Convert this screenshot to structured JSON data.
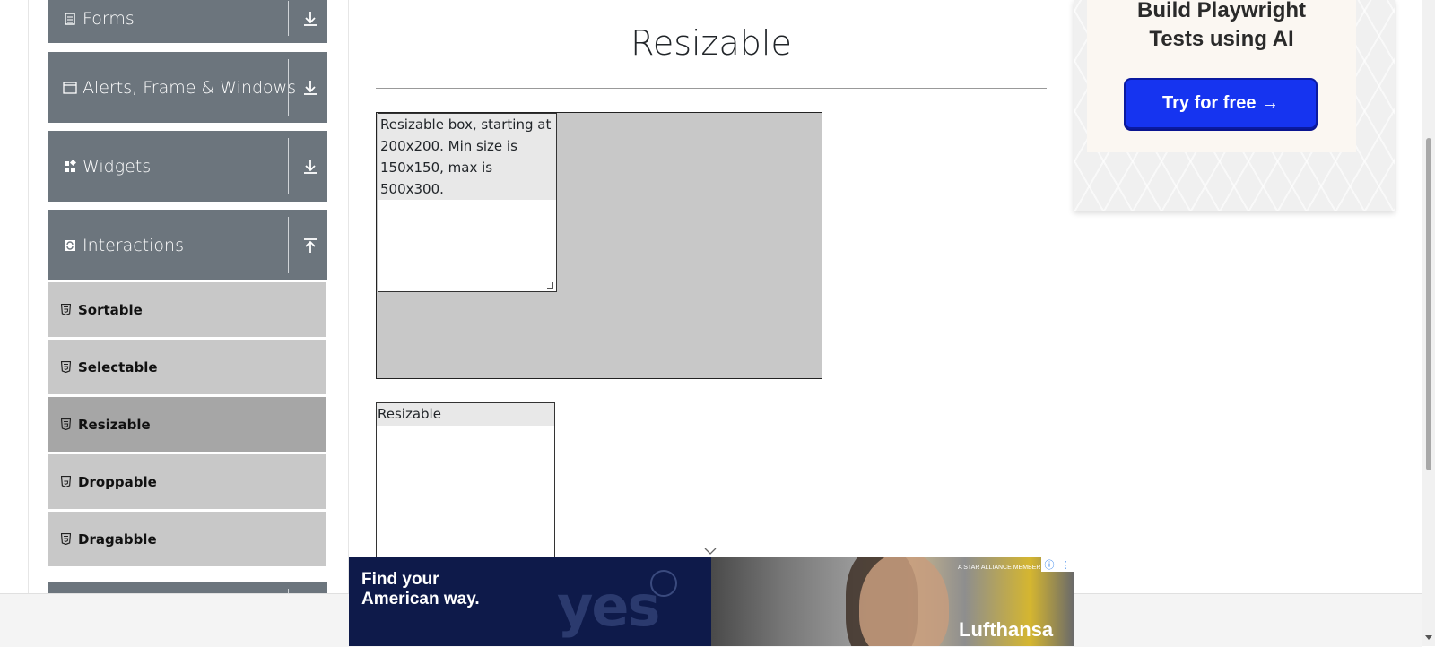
{
  "sidebar": {
    "groups": [
      {
        "label": "Forms",
        "icon": "document-icon",
        "state": "collapsed"
      },
      {
        "label": "Alerts, Frame & Windows",
        "icon": "window-icon",
        "state": "collapsed"
      },
      {
        "label": "Widgets",
        "icon": "widgets-icon",
        "state": "collapsed"
      },
      {
        "label": "Interactions",
        "icon": "interactions-icon",
        "state": "expanded"
      }
    ],
    "items": [
      {
        "label": "Sortable"
      },
      {
        "label": "Selectable"
      },
      {
        "label": "Resizable",
        "active": true
      },
      {
        "label": "Droppable"
      },
      {
        "label": "Dragabble"
      }
    ]
  },
  "main": {
    "title": "Resizable",
    "box1_text": "Resizable box, starting at 200x200. Min size is 150x150, max is 500x300.",
    "box2_text": "Resizable"
  },
  "ad_top": {
    "headline_line1": "Build Playwright",
    "headline_line2": "Tests using AI",
    "button_label": "Try for free →"
  },
  "ad_bottom": {
    "headline_line1": "Find your",
    "headline_line2": "American way.",
    "word": "yes",
    "member_text": "A STAR ALLIANCE MEMBER",
    "brand": "Lufthansa"
  },
  "colors": {
    "sidebar_header": "#6c757d",
    "sub_item": "#c8c8c8",
    "sub_item_active": "#a6a6a6",
    "ad_button": "#1634f0",
    "banner_navy": "#0e1a4a"
  }
}
